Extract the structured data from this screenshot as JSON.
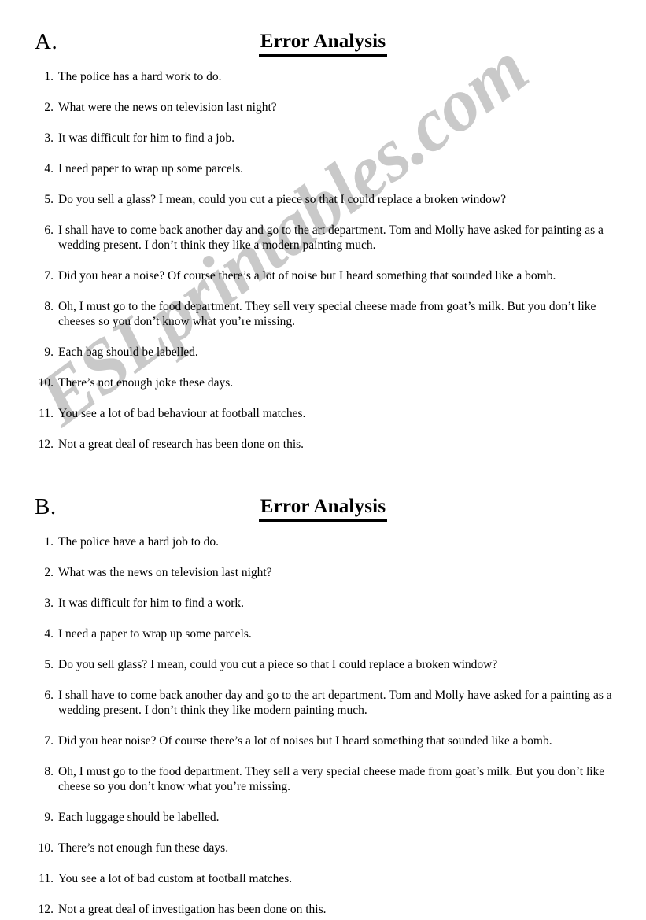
{
  "document": {
    "watermark": "ESLprintables.com"
  },
  "sections": [
    {
      "letter": "A.",
      "title": "Error Analysis",
      "items": [
        {
          "number": "1.",
          "text": "The police has a hard work to do."
        },
        {
          "number": "2.",
          "text": "What were the news on television last night?"
        },
        {
          "number": "3.",
          "text": "It was difficult for him to find a job."
        },
        {
          "number": "4.",
          "text": "I need paper to wrap up some parcels."
        },
        {
          "number": "5.",
          "text": "Do you sell a glass? I mean, could you cut a piece so that I could replace a broken window?"
        },
        {
          "number": "6.",
          "text": "I shall have to come back another day and go to the art department. Tom and Molly have asked for painting as a wedding present. I don’t think they like a modern painting much."
        },
        {
          "number": "7.",
          "text": "Did you hear a noise? Of course there’s a lot of noise but I heard something that sounded like a bomb."
        },
        {
          "number": "8.",
          "text": "Oh, I must go to the food department. They sell very special cheese made from goat’s milk. But you don’t like cheeses so you don’t know what you’re missing."
        },
        {
          "number": "9.",
          "text": "Each bag should be labelled."
        },
        {
          "number": "10.",
          "text": "There’s not enough joke these days."
        },
        {
          "number": "11.",
          "text": "You see a lot of bad behaviour at football matches."
        },
        {
          "number": "12.",
          "text": "Not a great deal of research has been done on this."
        }
      ]
    },
    {
      "letter": "B.",
      "title": "Error Analysis",
      "items": [
        {
          "number": "1.",
          "text": "The police have a hard job to do."
        },
        {
          "number": "2.",
          "text": "What was the news on television last night?"
        },
        {
          "number": "3.",
          "text": "It was difficult for him to find a work."
        },
        {
          "number": "4.",
          "text": "I need a paper to wrap up some parcels."
        },
        {
          "number": "5.",
          "text": "Do you sell glass? I mean, could you cut a piece so that I could replace a broken window?"
        },
        {
          "number": "6.",
          "text": "I shall have to come back another day and go to the art department. Tom and Molly have asked for a painting as a wedding present. I don’t think they like modern painting much."
        },
        {
          "number": "7.",
          "text": "Did you hear noise? Of course there’s a lot of noises but I heard something that sounded like a bomb."
        },
        {
          "number": "8.",
          "text": "Oh, I must go to the food department. They sell a very special cheese made from goat’s milk. But you don’t like cheese so you don’t know what you’re missing."
        },
        {
          "number": "9.",
          "text": "Each luggage should be labelled."
        },
        {
          "number": "10.",
          "text": "There’s not enough fun these days."
        },
        {
          "number": "11.",
          "text": "You see a lot of bad custom at football matches."
        },
        {
          "number": "12.",
          "text": "Not a great deal of investigation has been done on this."
        }
      ]
    }
  ]
}
